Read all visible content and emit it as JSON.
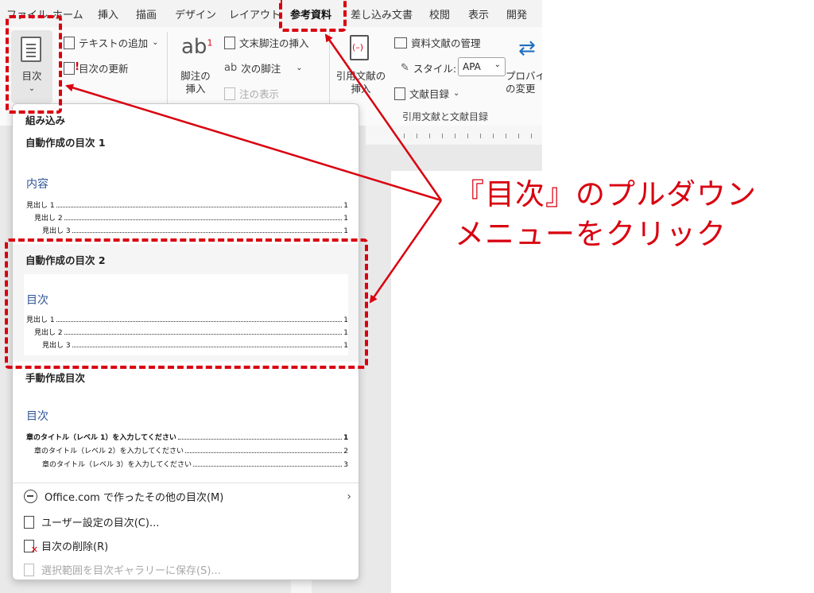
{
  "tabs": [
    {
      "label": "ファイル",
      "active": false
    },
    {
      "label": "ホーム",
      "active": false
    },
    {
      "label": "挿入",
      "active": false
    },
    {
      "label": "描画",
      "active": false
    },
    {
      "label": "デザイン",
      "active": false
    },
    {
      "label": "レイアウト",
      "active": false
    },
    {
      "label": "参考資料",
      "active": true
    },
    {
      "label": "差し込み文書",
      "active": false
    },
    {
      "label": "校閲",
      "active": false
    },
    {
      "label": "表示",
      "active": false
    },
    {
      "label": "開発",
      "active": false
    }
  ],
  "ribbon": {
    "toc_button": "目次",
    "toc_chevron": "⌄",
    "add_text": "テキストの追加",
    "update_toc": "目次の更新",
    "footnote_glyph": "ab",
    "footnote_sup": "1",
    "insert_footnote": "脚注の\n挿入",
    "insert_endnote": "文末脚注の挿入",
    "next_footnote": "次の脚注",
    "show_notes": "注の表示",
    "insert_citation": "引用文献の\n挿入",
    "manage_sources": "資料文献の管理",
    "style_label": "スタイル:",
    "style_value": "APA",
    "bibliography": "文献目録",
    "citations_group": "引用文献と文献目録",
    "provider": "プロバイ\nの変更"
  },
  "menu": {
    "builtin": "組み込み",
    "auto1": {
      "title": "自動作成の目次 1",
      "heading": "内容",
      "entries": [
        {
          "label": "見出し 1",
          "page": "1"
        },
        {
          "label": "見出し 2",
          "page": "1"
        },
        {
          "label": "見出し 3",
          "page": "1"
        }
      ]
    },
    "auto2": {
      "title": "自動作成の目次 2",
      "heading": "目次",
      "entries": [
        {
          "label": "見出し 1",
          "page": "1"
        },
        {
          "label": "見出し 2",
          "page": "1"
        },
        {
          "label": "見出し 3",
          "page": "1"
        }
      ]
    },
    "manual": {
      "title": "手動作成目次",
      "heading": "目次",
      "entries": [
        {
          "label": "章のタイトル（レベル 1）を入力してください",
          "page": "1"
        },
        {
          "label": "章のタイトル（レベル 2）を入力してください",
          "page": "2"
        },
        {
          "label": "章のタイトル（レベル 3）を入力してください",
          "page": "3"
        }
      ]
    },
    "items": {
      "office": "Office.com で作ったその他の目次(M)",
      "custom": "ユーザー設定の目次(C)...",
      "remove": "目次の削除(R)",
      "save": "選択範囲を目次ギャラリーに保存(S)..."
    },
    "submenu_arrow": "›"
  },
  "annotation": {
    "line1": "『目次』のプルダウン",
    "line2": "メニューをクリック",
    "color": "#d9000f"
  }
}
